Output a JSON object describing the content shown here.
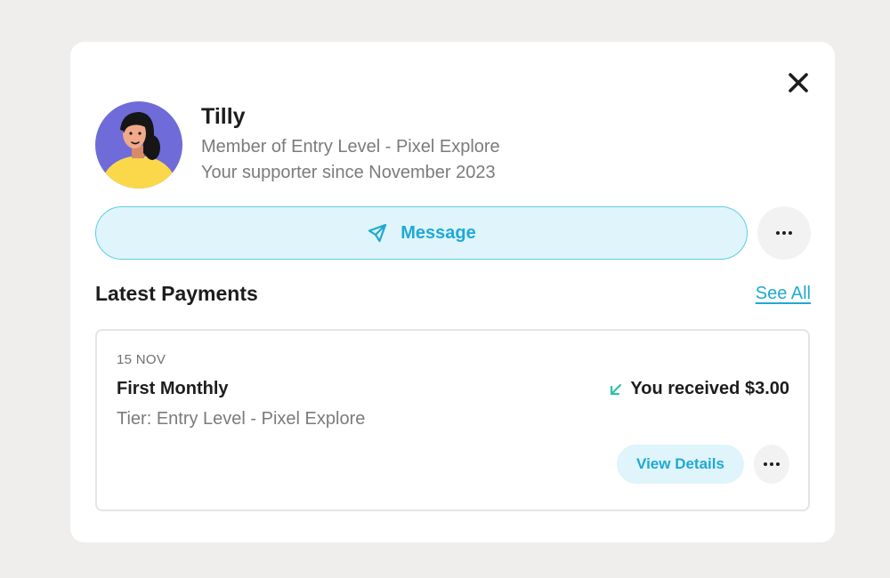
{
  "profile": {
    "name": "Tilly",
    "membership": "Member of Entry Level - Pixel Explore",
    "supporter_since": "Your supporter since November 2023"
  },
  "actions": {
    "message_label": "Message"
  },
  "payments": {
    "section_title": "Latest Payments",
    "see_all_label": "See All",
    "items": [
      {
        "date": "15 NOV",
        "title": "First Monthly",
        "tier": "Tier: Entry Level - Pixel Explore",
        "amount_text": "You received $3.00",
        "details_label": "View Details"
      }
    ]
  },
  "icons": {
    "close": "close-icon",
    "message": "send-icon",
    "more": "more-horizontal-icon",
    "received": "arrow-down-left-icon"
  },
  "colors": {
    "accent": "#1fa9d4",
    "accent_bg": "#dff4fb",
    "received_arrow": "#2ec4a0",
    "avatar_bg": "#6f6bd8",
    "avatar_shirt": "#fbd84a"
  }
}
